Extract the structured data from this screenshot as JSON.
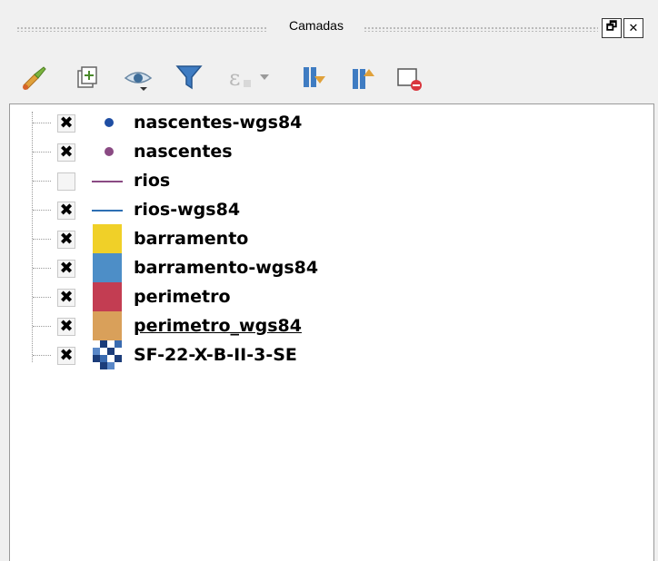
{
  "panel": {
    "title": "Camadas",
    "float_glyph": "🗗",
    "close_glyph": "✕"
  },
  "toolbar": {
    "tools": [
      "paintbrush-icon",
      "add-group-icon",
      "eye-visibility-icon",
      "filter-icon",
      "filter-expression-icon",
      "expand-all-icon",
      "collapse-all-icon",
      "remove-layer-icon"
    ]
  },
  "layers": [
    {
      "name": "nascentes-wgs84",
      "checked": true,
      "symbol": "point",
      "color": "#1f4ea3"
    },
    {
      "name": "nascentes",
      "checked": true,
      "symbol": "point",
      "color": "#8a4a83"
    },
    {
      "name": "rios",
      "checked": false,
      "symbol": "line",
      "color": "#8a4a83"
    },
    {
      "name": "rios-wgs84",
      "checked": true,
      "symbol": "line",
      "color": "#2d6fb3"
    },
    {
      "name": "barramento",
      "checked": true,
      "symbol": "polygon",
      "color": "#f0d028"
    },
    {
      "name": "barramento-wgs84",
      "checked": true,
      "symbol": "polygon",
      "color": "#4d8ec7"
    },
    {
      "name": "perimetro",
      "checked": true,
      "symbol": "polygon",
      "color": "#c33d52"
    },
    {
      "name": "perimetro_wgs84",
      "checked": true,
      "symbol": "polygon",
      "color": "#d9a05a",
      "selected": true
    },
    {
      "name": "SF-22-X-B-II-3-SE",
      "checked": true,
      "symbol": "raster",
      "color": "#1c3d7a"
    }
  ]
}
